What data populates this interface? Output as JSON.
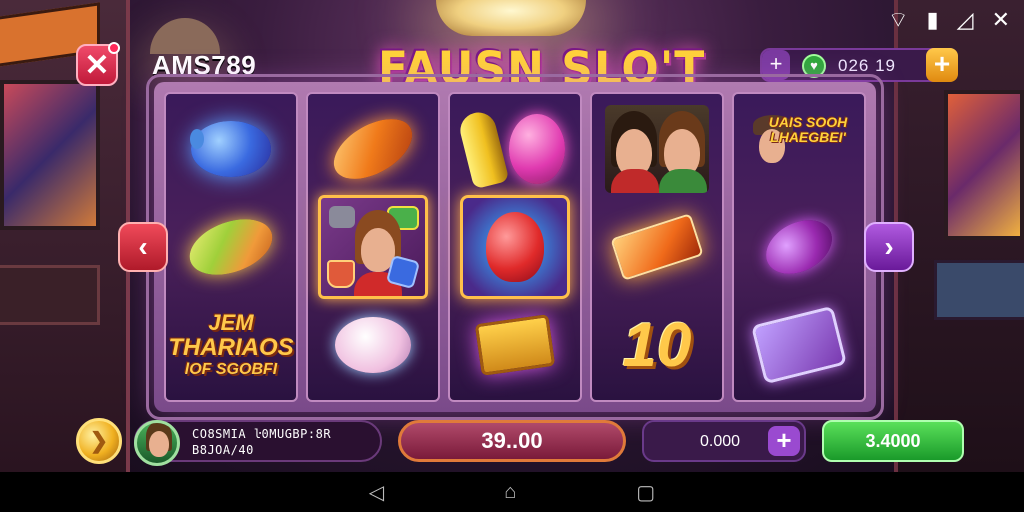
{
  "header": {
    "username": "AMS789",
    "title": "FAUSN SLO'T",
    "balance": "026 19",
    "close_icon": "close-icon",
    "status": {
      "wifi": "wifi-icon",
      "battery": "battery-icon",
      "signal": "no-signal-icon",
      "close": "close-icon"
    }
  },
  "reels": {
    "reel1": {
      "text_symbol": {
        "l1": "JEM",
        "l2": "THARIAOS",
        "l3": "lOF SGOBFI"
      }
    },
    "reel4": {
      "big_number": "10"
    },
    "reel5": {
      "sign_text": "UAIS SOOH LHAEGBEI'"
    }
  },
  "bottom": {
    "player_line1": "CO8SMIA ŀ0MUGBP:8R",
    "player_line2": "B8JOA/40",
    "bet": "39..00",
    "win": "0.000",
    "spin_value": "3.4000"
  },
  "nav": {
    "back": "◁",
    "home": "⌂",
    "recents": "▢"
  },
  "colors": {
    "title": "#ffd23a",
    "spin": "#2ab53a",
    "close": "#e03050",
    "nav_right": "#8a3ad0"
  }
}
